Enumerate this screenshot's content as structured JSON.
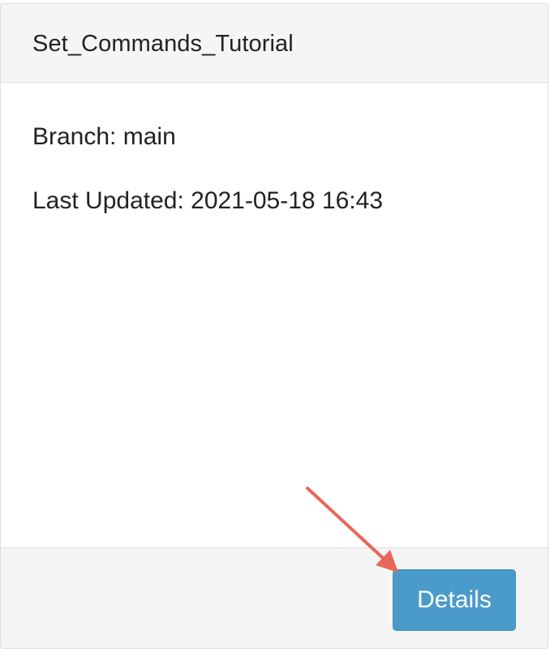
{
  "card": {
    "title": "Set_Commands_Tutorial",
    "branch": "Branch: main",
    "last_updated": "Last Updated: 2021-05-18 16:43",
    "details_label": "Details"
  },
  "colors": {
    "header_bg": "#f5f5f5",
    "button_bg": "#4a9bc9",
    "arrow": "#e8675a"
  }
}
